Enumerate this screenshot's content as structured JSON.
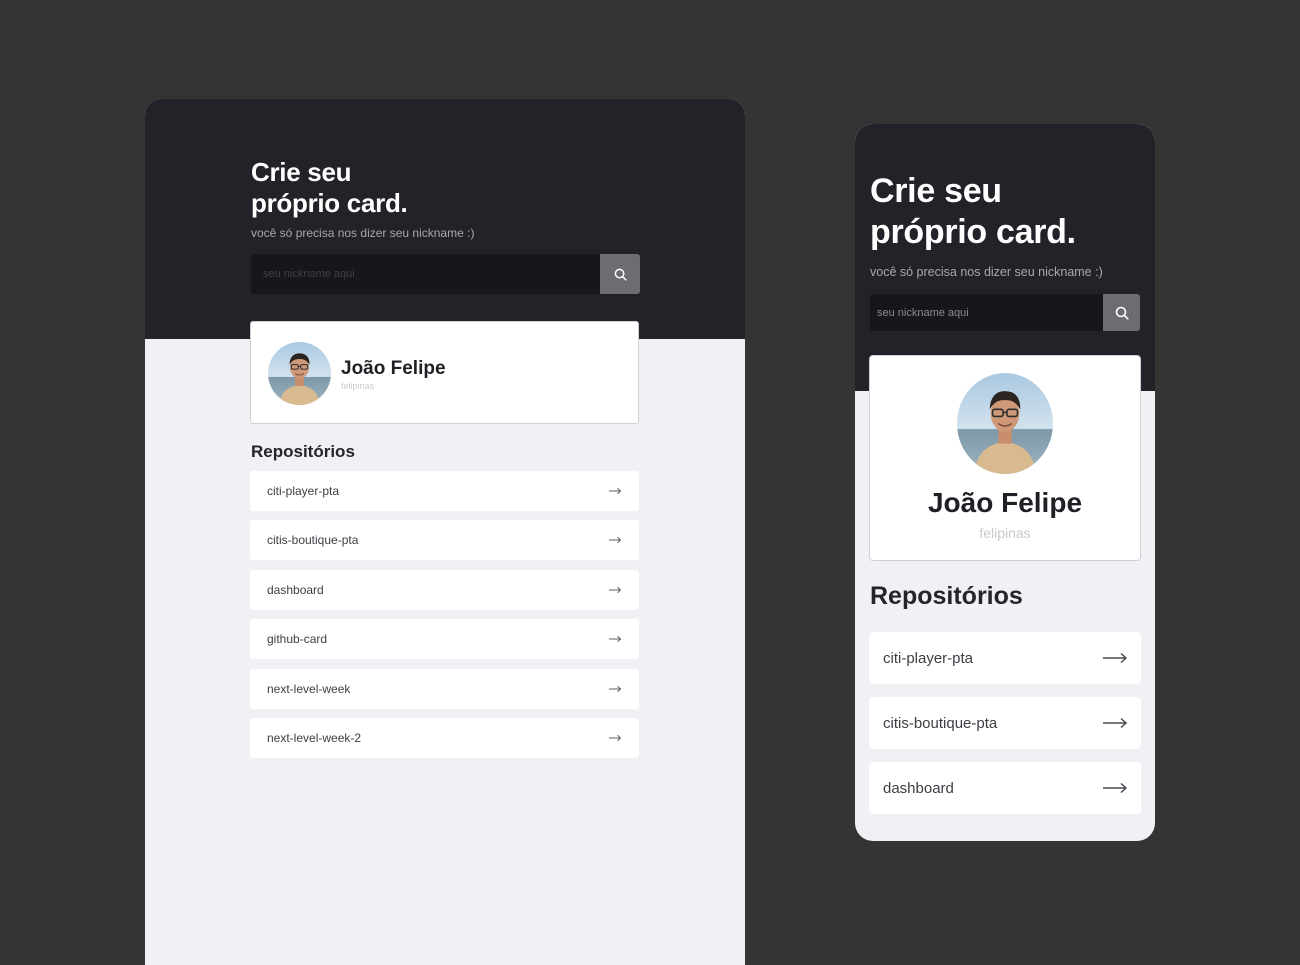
{
  "desktop": {
    "title_line1": "Crie seu",
    "title_line2": "próprio card.",
    "subtitle": "você só precisa nos dizer seu nickname :)",
    "search_placeholder": "seu nickname aqui",
    "search_icon": "search-icon",
    "profile": {
      "name": "João Felipe",
      "username": "felipinas"
    },
    "repos_heading": "Repositórios",
    "repos": [
      {
        "name": "citi-player-pta"
      },
      {
        "name": "citis-boutique-pta"
      },
      {
        "name": "dashboard"
      },
      {
        "name": "github-card"
      },
      {
        "name": "next-level-week"
      },
      {
        "name": "next-level-week-2"
      }
    ]
  },
  "mobile": {
    "title_line1": "Crie seu",
    "title_line2": "próprio card.",
    "subtitle": "você só precisa nos dizer seu nickname :)",
    "search_placeholder": "seu nickname aqui",
    "search_icon": "search-icon",
    "profile": {
      "name": "João Felipe",
      "username": "felipinas"
    },
    "repos_heading": "Repositórios",
    "repos": [
      {
        "name": "citi-player-pta"
      },
      {
        "name": "citis-boutique-pta"
      },
      {
        "name": "dashboard"
      }
    ]
  },
  "colors": {
    "canvas": "#343434",
    "hero": "#212329",
    "body": "#f0f1f5",
    "search_field": "#16171b",
    "search_button": "#6c6d73"
  }
}
